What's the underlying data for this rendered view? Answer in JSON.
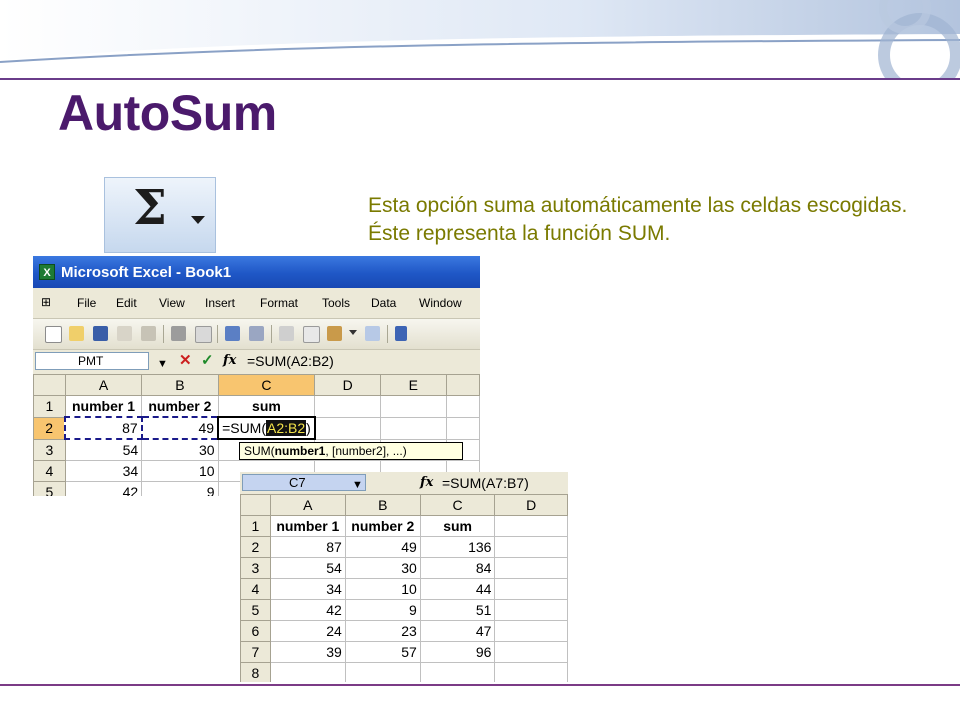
{
  "slide": {
    "title": "AutoSum",
    "description": "Esta opción suma automáticamente las celdas escogidas. Éste representa la función SUM.",
    "sigma_icon": "autosum-sigma-icon",
    "accent_color": "#4b1a6c",
    "text_color": "#7a7a00"
  },
  "excel1": {
    "window_title": "Microsoft Excel - Book1",
    "menu": [
      "File",
      "Edit",
      "View",
      "Insert",
      "Format",
      "Tools",
      "Data",
      "Window"
    ],
    "name_box": "PMT",
    "formula": "=SUM(A2:B2)",
    "columns": [
      "A",
      "B",
      "C",
      "D",
      "E"
    ],
    "rows": [
      {
        "row": "1",
        "cells": [
          "number 1",
          "number 2",
          "sum",
          "",
          ""
        ]
      },
      {
        "row": "2",
        "cells": [
          "87",
          "49",
          "=SUM(",
          "",
          ""
        ],
        "ref": "A2:B2",
        "close": ")"
      },
      {
        "row": "3",
        "cells": [
          "54",
          "30",
          "",
          "",
          ""
        ]
      },
      {
        "row": "4",
        "cells": [
          "34",
          "10",
          "",
          "",
          ""
        ]
      },
      {
        "row": "5",
        "cells": [
          "42",
          "9",
          "",
          "",
          ""
        ]
      }
    ],
    "tooltip_prefix": "SUM(",
    "tooltip_arg1": "number1",
    "tooltip_rest": ", [number2], ...)"
  },
  "excel2": {
    "name_box": "C7",
    "formula": "=SUM(A7:B7)",
    "columns": [
      "A",
      "B",
      "C",
      "D"
    ],
    "rows": [
      {
        "row": "1",
        "cells": [
          "number 1",
          "number 2",
          "sum",
          ""
        ]
      },
      {
        "row": "2",
        "cells": [
          "87",
          "49",
          "136",
          ""
        ]
      },
      {
        "row": "3",
        "cells": [
          "54",
          "30",
          "84",
          ""
        ]
      },
      {
        "row": "4",
        "cells": [
          "34",
          "10",
          "44",
          ""
        ]
      },
      {
        "row": "5",
        "cells": [
          "42",
          "9",
          "51",
          ""
        ]
      },
      {
        "row": "6",
        "cells": [
          "24",
          "23",
          "47",
          ""
        ]
      },
      {
        "row": "7",
        "cells": [
          "39",
          "57",
          "96",
          ""
        ]
      },
      {
        "row": "8",
        "cells": [
          "",
          "",
          "",
          ""
        ]
      }
    ]
  }
}
